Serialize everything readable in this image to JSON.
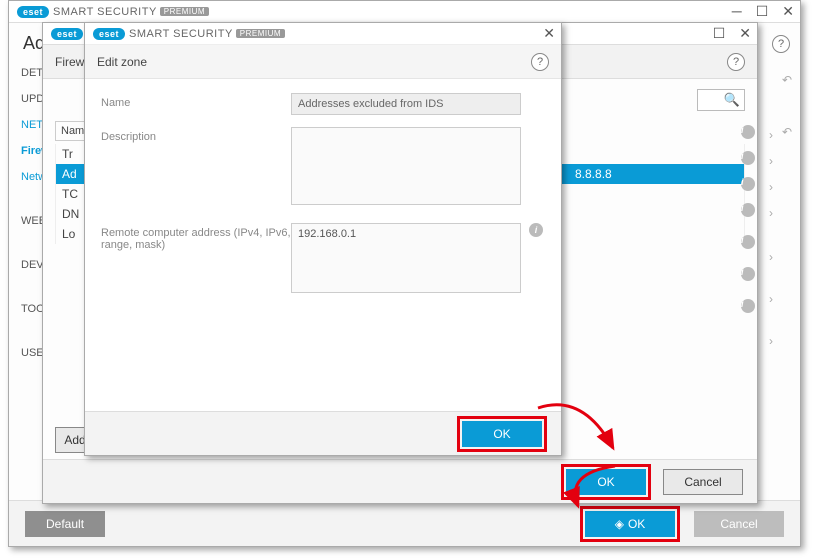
{
  "brand": {
    "eset": "eset",
    "product": "SMART SECURITY",
    "edition": "PREMIUM"
  },
  "main": {
    "title": "Advanced",
    "sidebar": [
      "DETEC",
      "UPDAT",
      "NETW",
      "Firew",
      "Netwo",
      "",
      "WEB A",
      "",
      "DEVIC",
      "",
      "TOOLS",
      "",
      "USER"
    ],
    "sidebar_active_index": 3,
    "default_btn": "Default",
    "ok_btn": "OK",
    "cancel_btn": "Cancel"
  },
  "firewall": {
    "subtitle": "Firew",
    "col_name": "Name",
    "rows": [
      "Tr",
      "Ad",
      "TC",
      "DN",
      "Lo"
    ],
    "selected_index": 1,
    "ip_value": "8.8.8.8",
    "add_btn": "Add",
    "ok_btn": "OK",
    "cancel_btn": "Cancel"
  },
  "editzone": {
    "title": "Edit zone",
    "name_label": "Name",
    "name_value": "Addresses excluded from IDS",
    "desc_label": "Description",
    "desc_value": "",
    "addr_label": "Remote computer address (IPv4, IPv6, range, mask)",
    "addr_value": "192.168.0.1",
    "ok_btn": "OK"
  }
}
